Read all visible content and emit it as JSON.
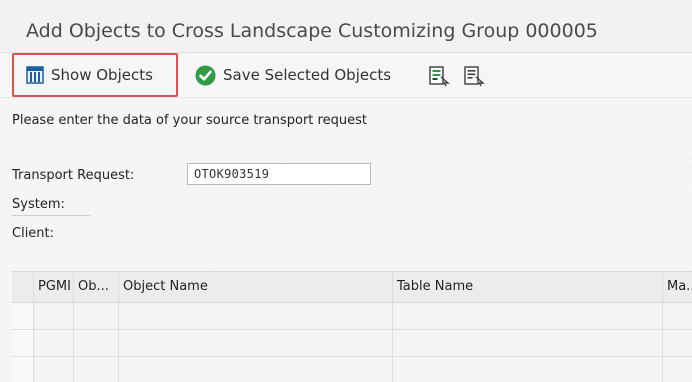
{
  "header": {
    "title": "Add Objects to Cross Landscape Customizing Group 000005"
  },
  "toolbar": {
    "show_objects_label": "Show Objects",
    "save_selected_label": "Save Selected Objects",
    "icons": [
      "grid-icon",
      "check-icon",
      "doc-export-icon",
      "doc-import-icon"
    ]
  },
  "form": {
    "instructions": "Please enter the data of your source transport request",
    "transport_request_label": "Transport Request:",
    "transport_request_value": "OTOK903519",
    "system_label": "System:",
    "client_label": "Client:"
  },
  "table": {
    "columns": [
      "",
      "PGMI",
      "Ob...",
      "Object Name",
      "Table Name",
      "Ma..."
    ],
    "rows": 3
  },
  "colors": {
    "highlight": "#d9534f",
    "accent": "#1a5fa8",
    "success": "#2f9b45"
  }
}
